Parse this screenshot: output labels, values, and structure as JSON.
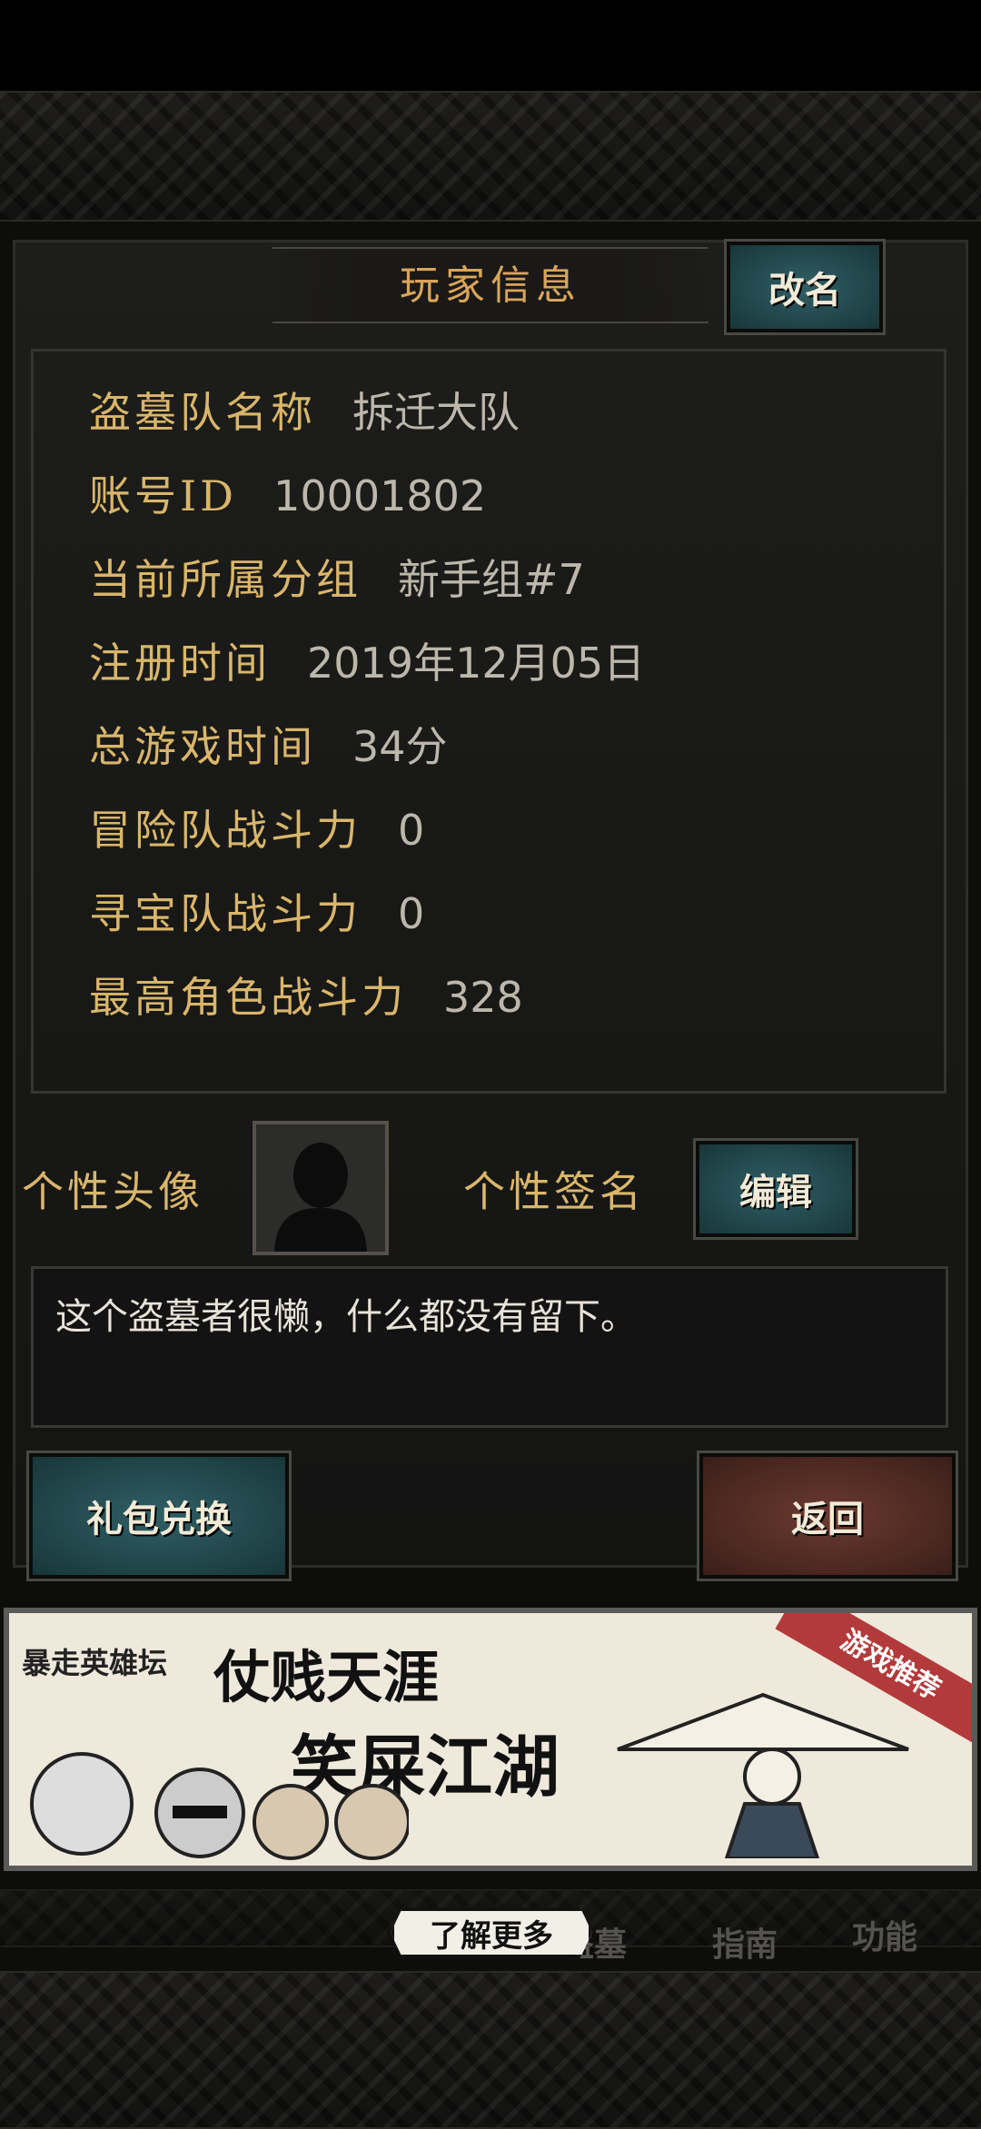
{
  "title": "玩家信息",
  "rename_button": "改名",
  "info": [
    {
      "label": "盗墓队名称",
      "value": "拆迁大队"
    },
    {
      "label": "账号ID",
      "value": "10001802"
    },
    {
      "label": "当前所属分组",
      "value": "新手组#7"
    },
    {
      "label": "注册时间",
      "value": "2019年12月05日"
    },
    {
      "label": "总游戏时间",
      "value": "34分"
    },
    {
      "label": "冒险队战斗力",
      "value": "0"
    },
    {
      "label": "寻宝队战斗力",
      "value": "0"
    },
    {
      "label": "最高角色战斗力",
      "value": "328"
    }
  ],
  "avatar_label": "个性头像",
  "signature_label": "个性签名",
  "edit_button": "编辑",
  "signature_text": "这个盗墓者很懒，什么都没有留下。",
  "gift_button": "礼包兑换",
  "back_button": "返回",
  "ad": {
    "logo_text": "暴走英雄坛",
    "line1": "仗贱天涯",
    "line2": "笑屎江湖",
    "ribbon": "游戏推荐",
    "learn_more": "了解更多"
  },
  "bottom_nav": [
    "盗墓",
    "指南",
    "功能"
  ]
}
